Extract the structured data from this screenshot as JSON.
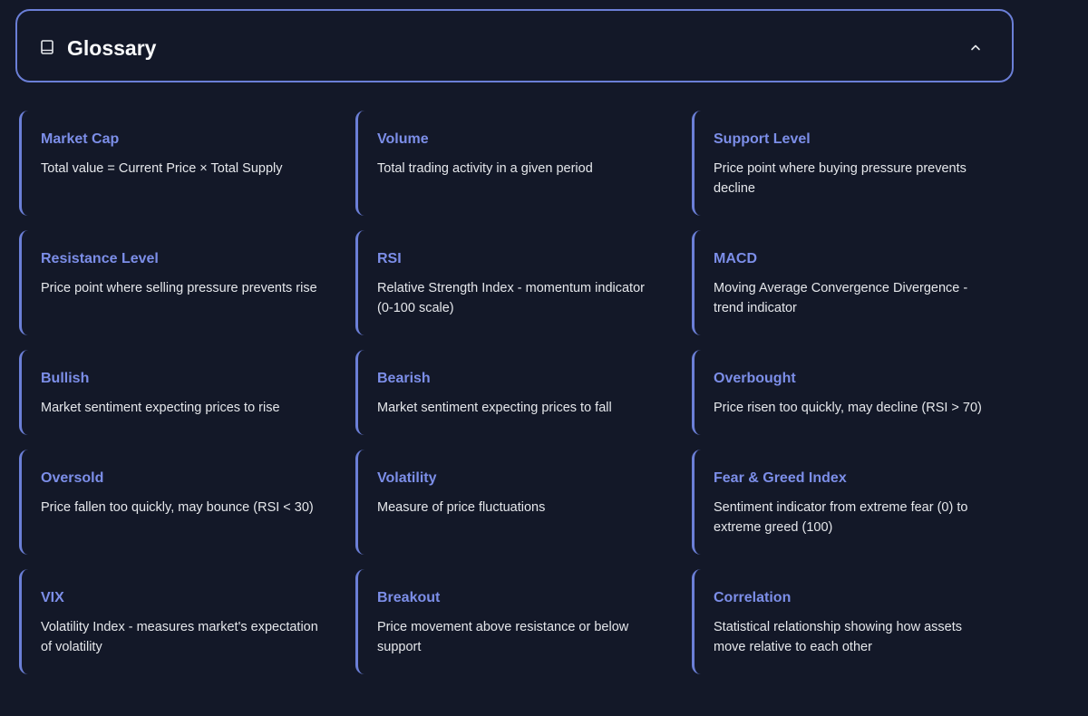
{
  "glossary": {
    "title": "Glossary",
    "icons": {
      "header": "book-icon",
      "toggle": "chevron-up-icon"
    },
    "accent_color": "#6b7fd7",
    "terms": [
      {
        "term": "Market Cap",
        "definition": "Total value = Current Price × Total Supply"
      },
      {
        "term": "Volume",
        "definition": "Total trading activity in a given period"
      },
      {
        "term": "Support Level",
        "definition": "Price point where buying pressure prevents decline"
      },
      {
        "term": "Resistance Level",
        "definition": "Price point where selling pressure prevents rise"
      },
      {
        "term": "RSI",
        "definition": "Relative Strength Index - momentum indicator (0-100 scale)"
      },
      {
        "term": "MACD",
        "definition": "Moving Average Convergence Divergence - trend indicator"
      },
      {
        "term": "Bullish",
        "definition": "Market sentiment expecting prices to rise"
      },
      {
        "term": "Bearish",
        "definition": "Market sentiment expecting prices to fall"
      },
      {
        "term": "Overbought",
        "definition": "Price risen too quickly, may decline (RSI > 70)"
      },
      {
        "term": "Oversold",
        "definition": "Price fallen too quickly, may bounce (RSI < 30)"
      },
      {
        "term": "Volatility",
        "definition": "Measure of price fluctuations"
      },
      {
        "term": "Fear & Greed Index",
        "definition": "Sentiment indicator from extreme fear (0) to extreme greed (100)"
      },
      {
        "term": "VIX",
        "definition": "Volatility Index - measures market's expectation of volatility"
      },
      {
        "term": "Breakout",
        "definition": "Price movement above resistance or below support"
      },
      {
        "term": "Correlation",
        "definition": "Statistical relationship showing how assets move relative to each other"
      }
    ]
  }
}
